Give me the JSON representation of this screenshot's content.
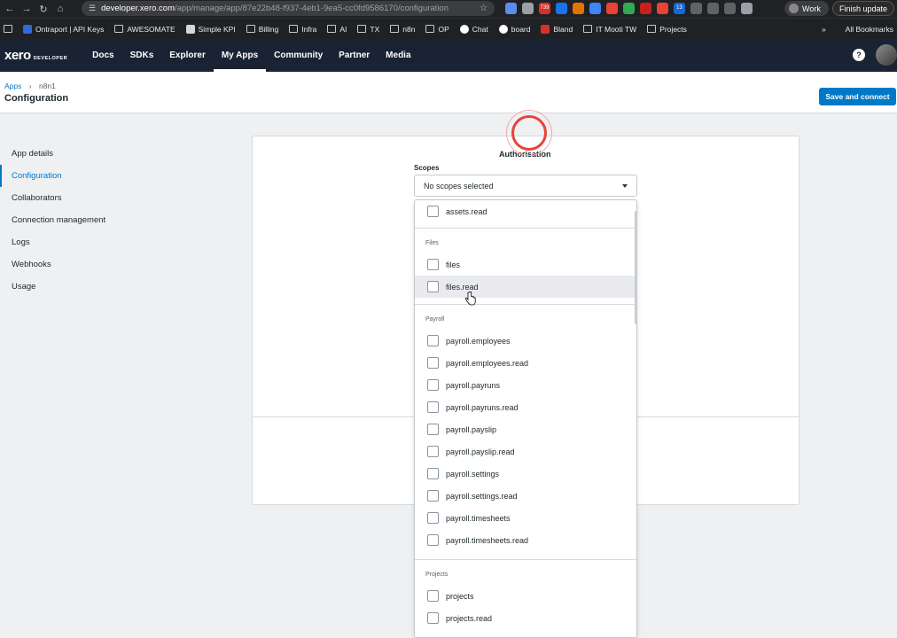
{
  "browser": {
    "url_domain": "developer.xero.com",
    "url_path": "/app/manage/app/87e22b48-f937-4eb1-9ea5-cc0fd9586170/configuration",
    "badges": [
      "739",
      "13"
    ],
    "profile": "Work",
    "update_label": "Finish update"
  },
  "bookmarks": {
    "items": [
      "Ontraport | API Keys",
      "AWESOMATE",
      "Simple KPI",
      "Billing",
      "Infra",
      "AI",
      "TX",
      "n8n",
      "OP",
      "Chat",
      "board",
      "Bland",
      "IT Mooti TW",
      "Projects"
    ],
    "all_bookmarks": "All Bookmarks"
  },
  "xero": {
    "logo": "xero",
    "logo_sub": "DEVELOPER",
    "nav": [
      "Docs",
      "SDKs",
      "Explorer",
      "My Apps",
      "Community",
      "Partner",
      "Media"
    ],
    "active_nav": "My Apps",
    "help": "?"
  },
  "page": {
    "crumb_root": "Apps",
    "crumb_sep": "›",
    "crumb_current": "n8n1",
    "title": "Configuration",
    "save_button": "Save and connect"
  },
  "sidenav": [
    "App details",
    "Configuration",
    "Collaborators",
    "Connection management",
    "Logs",
    "Webhooks",
    "Usage"
  ],
  "sidenav_active": "Configuration",
  "auth": {
    "title": "Authorisation",
    "scopes_label": "Scopes",
    "select_value": "No scopes selected"
  },
  "dropdown": {
    "top_item": "assets.read",
    "groups": [
      {
        "name": "Files",
        "items": [
          "files",
          "files.read"
        ]
      },
      {
        "name": "Payroll",
        "items": [
          "payroll.employees",
          "payroll.employees.read",
          "payroll.payruns",
          "payroll.payruns.read",
          "payroll.payslip",
          "payroll.payslip.read",
          "payroll.settings",
          "payroll.settings.read",
          "payroll.timesheets",
          "payroll.timesheets.read"
        ]
      },
      {
        "name": "Projects",
        "items": [
          "projects",
          "projects.read"
        ]
      }
    ],
    "hovered_item": "files.read"
  }
}
